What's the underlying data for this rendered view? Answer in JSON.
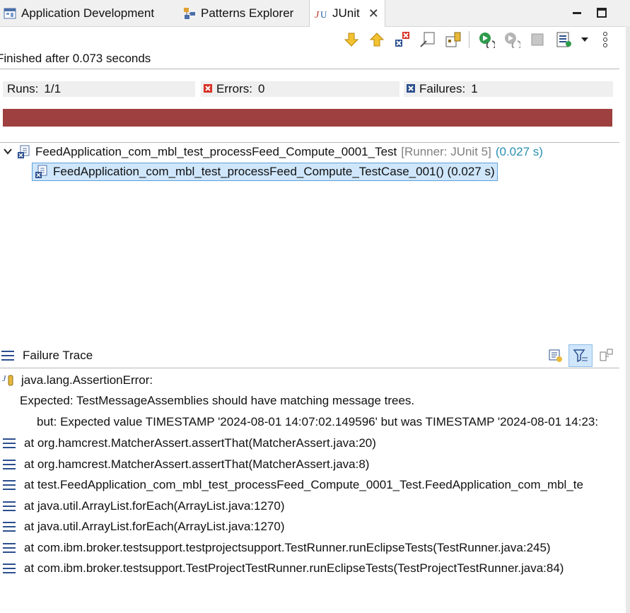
{
  "tabs": [
    {
      "label": "Application Development",
      "icon": "application-development-icon"
    },
    {
      "label": "Patterns Explorer",
      "icon": "patterns-explorer-icon"
    },
    {
      "label": "JUnit",
      "icon": "junit-icon",
      "active": true
    }
  ],
  "status": "Finished after 0.073 seconds",
  "counters": {
    "runs_label": "Runs:",
    "runs_value": "1/1",
    "errors_label": "Errors:",
    "errors_value": "0",
    "failures_label": "Failures:",
    "failures_value": "1"
  },
  "progress": {
    "fraction": 1.0,
    "color": "#9e4040"
  },
  "tree": {
    "suite_name": "FeedApplication_com_mbl_test_processFeed_Compute_0001_Test",
    "suite_runner": "[Runner: JUnit 5]",
    "suite_time": "(0.027 s)",
    "case_label": "FeedApplication_com_mbl_test_processFeed_Compute_TestCase_001() (0.027 s)"
  },
  "trace": {
    "title": "Failure Trace",
    "error": "java.lang.AssertionError:",
    "expected": "Expected: TestMessageAssemblies should have matching message trees.",
    "but": "but: Expected value TIMESTAMP '2024-08-01 14:07:02.149596' but was TIMESTAMP '2024-08-01 14:23:",
    "frames": [
      "at org.hamcrest.MatcherAssert.assertThat(MatcherAssert.java:20)",
      "at org.hamcrest.MatcherAssert.assertThat(MatcherAssert.java:8)",
      "at test.FeedApplication_com_mbl_test_processFeed_Compute_0001_Test.FeedApplication_com_mbl_te",
      "at java.util.ArrayList.forEach(ArrayList.java:1270)",
      "at java.util.ArrayList.forEach(ArrayList.java:1270)",
      "at com.ibm.broker.testsupport.testprojectsupport.TestRunner.runEclipseTests(TestRunner.java:245)",
      "at com.ibm.broker.testsupport.TestProjectTestRunner.runEclipseTests(TestProjectTestRunner.java:84)"
    ]
  }
}
